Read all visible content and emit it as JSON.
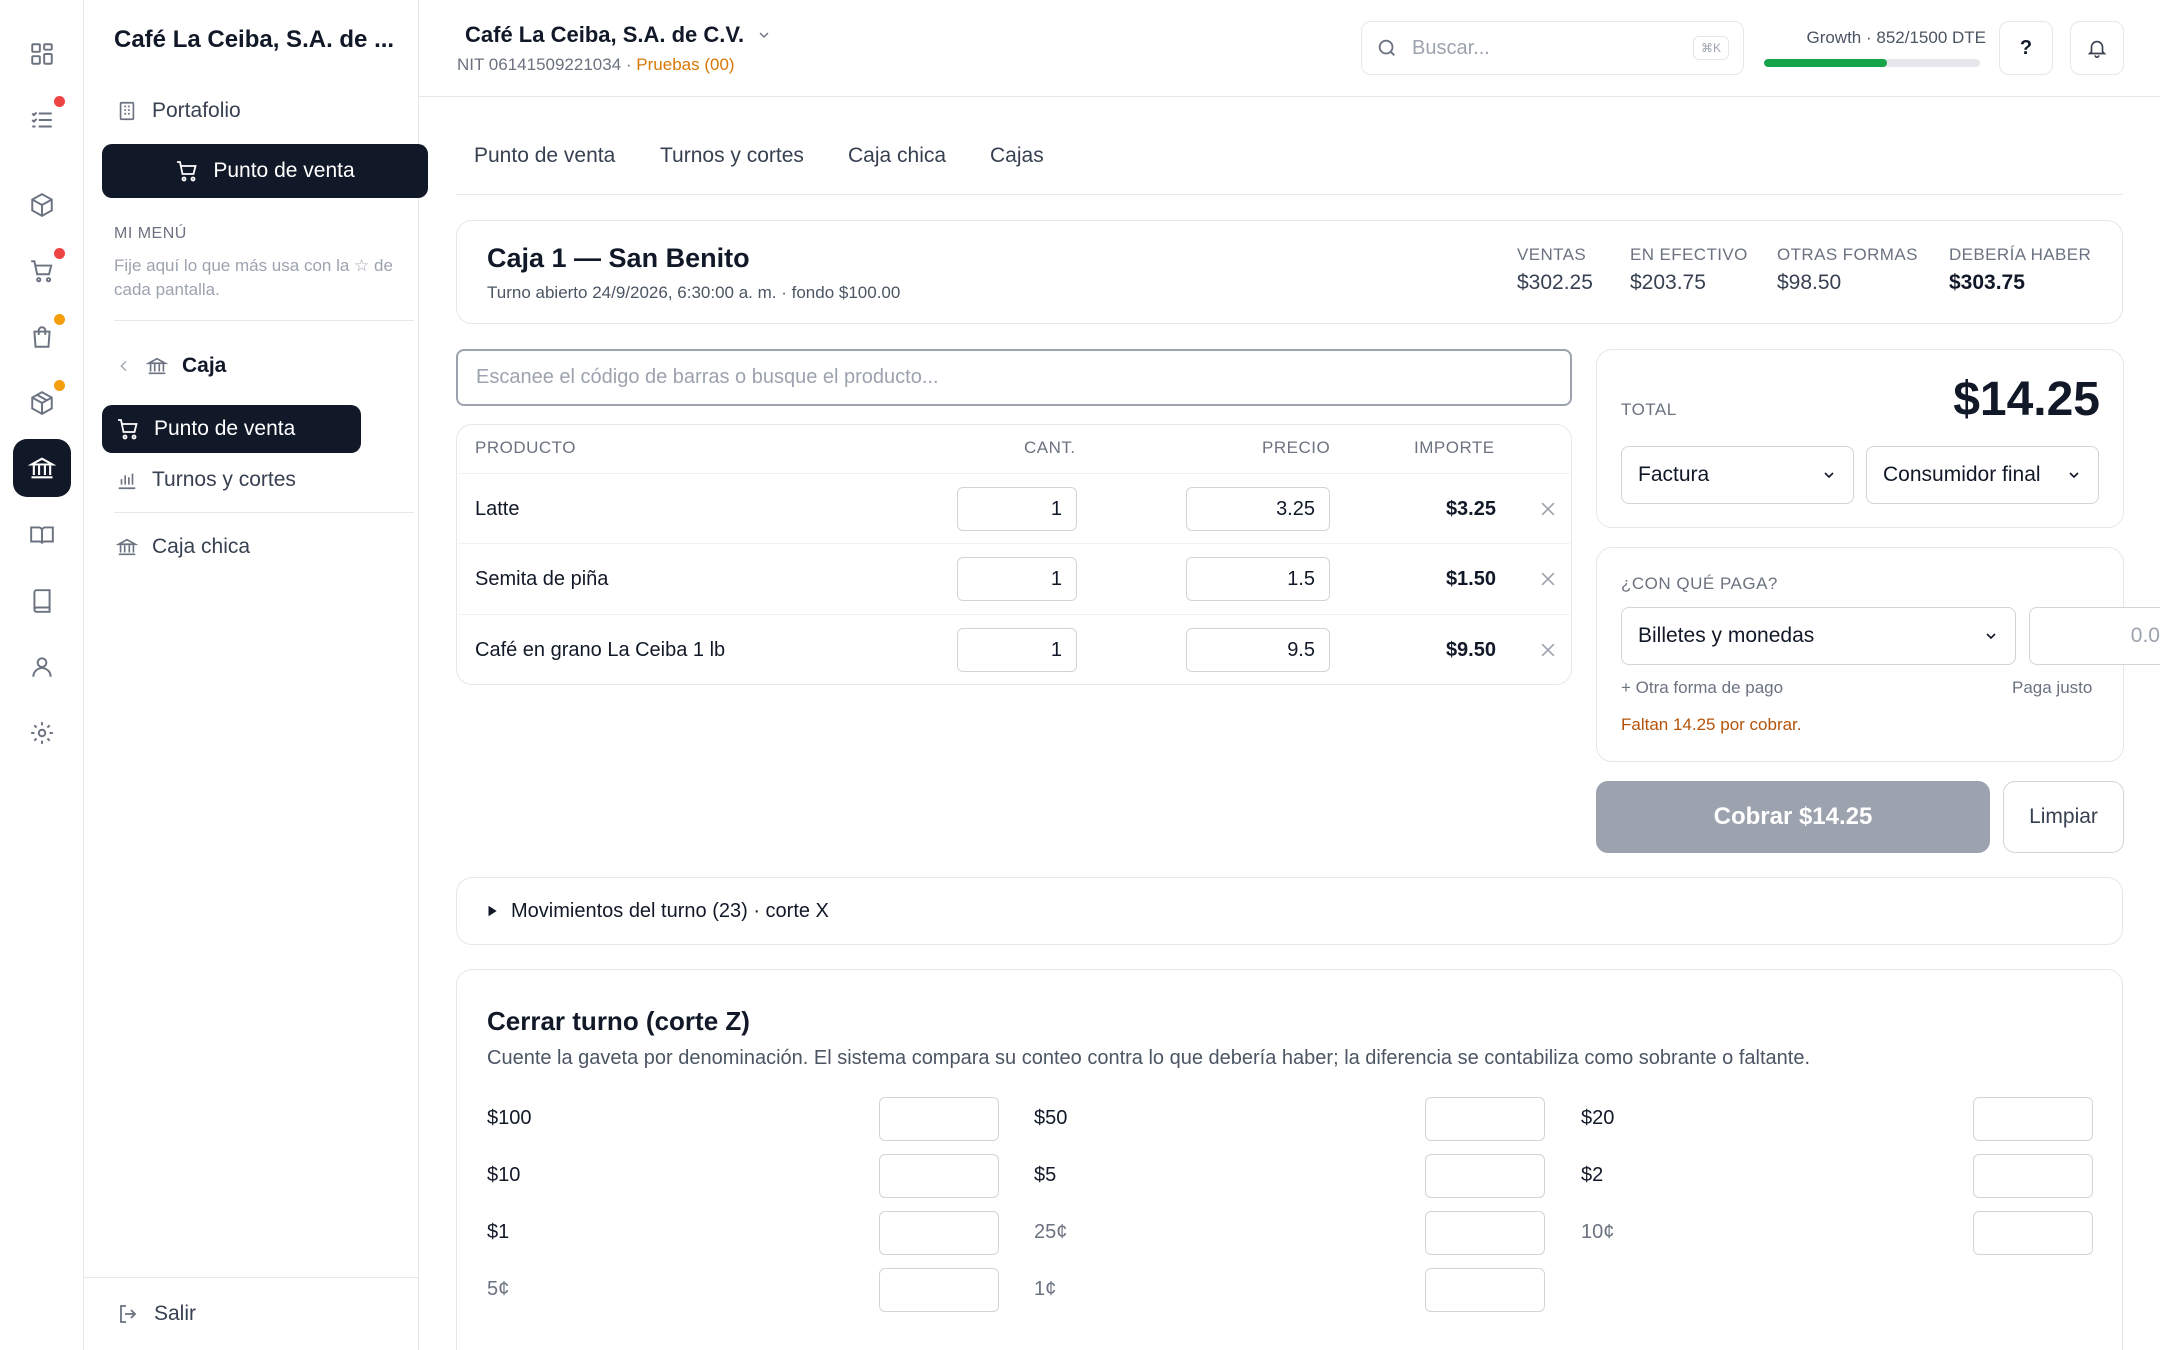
{
  "rail": {
    "items": [
      {
        "icon": "dashboard-icon"
      },
      {
        "icon": "tasks-icon",
        "dot": "#ef4444"
      },
      {
        "icon": "box-icon"
      },
      {
        "icon": "cart-icon",
        "dot": "#ef4444"
      },
      {
        "icon": "bag-icon",
        "dot": "#f59e0b"
      },
      {
        "icon": "package-icon",
        "dot": "#f59e0b"
      },
      {
        "icon": "bank-icon",
        "active": true
      },
      {
        "icon": "open-book-icon"
      },
      {
        "icon": "book-icon"
      },
      {
        "icon": "user-icon"
      },
      {
        "icon": "settings-icon"
      }
    ]
  },
  "sidebar": {
    "company": "Café La Ceiba, S.A. de ...",
    "portfolio": "Portafolio",
    "pos_main": "Punto de venta",
    "my_menu_label": "MI MENÚ",
    "my_menu_hint": "Fije aquí lo que más usa con la ☆ de cada pantalla.",
    "section": "Caja",
    "items": [
      "Punto de venta",
      "Turnos y cortes",
      "Caja chica"
    ],
    "logout": "Salir"
  },
  "topbar": {
    "org_name": "Café La Ceiba, S.A. de C.V.",
    "nit": "NIT 06141509221034 · ",
    "env": "Pruebas (00)",
    "search_placeholder": "Buscar...",
    "search_kbd": "⌘K",
    "plan": "Growth · 852/1500 DTE",
    "plan_used": 852,
    "plan_total": 1500,
    "help": "?"
  },
  "tabs": [
    "Punto de venta",
    "Turnos y cortes",
    "Caja chica",
    "Cajas"
  ],
  "register": {
    "title": "Caja 1 — San Benito",
    "subtitle": "Turno abierto 24/9/2026, 6:30:00 a. m. · fondo $100.00",
    "stats": [
      {
        "label": "VENTAS",
        "value": "$302.25"
      },
      {
        "label": "EN EFECTIVO",
        "value": "$203.75"
      },
      {
        "label": "OTRAS FORMAS",
        "value": "$98.50"
      },
      {
        "label": "DEBERÍA HABER",
        "value": "$303.75"
      }
    ]
  },
  "scan_placeholder": "Escanee el código de barras o busque el producto...",
  "table": {
    "headers": {
      "product": "PRODUCTO",
      "qty": "CANT.",
      "price": "PRECIO",
      "amount": "IMPORTE"
    },
    "rows": [
      {
        "name": "Latte",
        "qty": "1",
        "price": "3.25",
        "amount": "$3.25"
      },
      {
        "name": "Semita de piña",
        "qty": "1",
        "price": "1.5",
        "amount": "$1.50"
      },
      {
        "name": "Café en grano La Ceiba 1 lb",
        "qty": "1",
        "price": "9.5",
        "amount": "$9.50"
      }
    ]
  },
  "checkout": {
    "total_label": "TOTAL",
    "total": "$14.25",
    "doc_type": "Factura",
    "customer": "Consumidor final",
    "pay_label": "¿CON QUÉ PAGA?",
    "method": "Billetes y monedas",
    "amount_placeholder": "0.0",
    "other_method": "+ Otra forma de pago",
    "exact": "Paga justo",
    "pending": "Faltan 14.25 por cobrar.",
    "charge": "Cobrar $14.25",
    "clear": "Limpiar"
  },
  "movements": "Movimientos del turno (23) · corte X",
  "close_shift": {
    "title": "Cerrar turno (corte Z)",
    "description": "Cuente la gaveta por denominación. El sistema compara su conteo contra lo que debería haber; la diferencia se contabiliza como sobrante o faltante.",
    "denominations": [
      "$100",
      "$50",
      "$20",
      "$10",
      "$5",
      "$2",
      "$1",
      "25¢",
      "10¢",
      "5¢",
      "1¢"
    ]
  }
}
